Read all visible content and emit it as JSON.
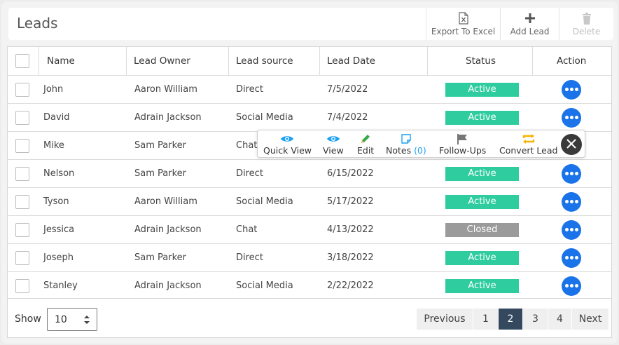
{
  "header": {
    "title": "Leads",
    "toolbar": [
      {
        "label": "Export To Excel",
        "icon": "excel-file-icon",
        "enabled": true
      },
      {
        "label": "Add Lead",
        "icon": "plus-icon",
        "enabled": true
      },
      {
        "label": "Delete",
        "icon": "trash-icon",
        "enabled": false
      }
    ]
  },
  "table": {
    "columns": [
      "Name",
      "Lead Owner",
      "Lead source",
      "Lead Date",
      "Status",
      "Action"
    ],
    "rows": [
      {
        "name": "John",
        "owner": "Aaron William",
        "source": "Direct",
        "date": "7/5/2022",
        "status": "Active"
      },
      {
        "name": "David",
        "owner": "Adrain Jackson",
        "source": "Social Media",
        "date": "7/4/2022",
        "status": "Active"
      },
      {
        "name": "Mike",
        "owner": "Sam Parker",
        "source": "Chat",
        "date": "",
        "status": ""
      },
      {
        "name": "Nelson",
        "owner": "Sam Parker",
        "source": "Direct",
        "date": "6/15/2022",
        "status": "Active"
      },
      {
        "name": "Tyson",
        "owner": "Aaron William",
        "source": "Social Media",
        "date": "5/17/2022",
        "status": "Active"
      },
      {
        "name": "Jessica",
        "owner": "Adrain Jackson",
        "source": "Chat",
        "date": "4/13/2022",
        "status": "Closed"
      },
      {
        "name": "Joseph",
        "owner": "Sam Parker",
        "source": "Direct",
        "date": "3/18/2022",
        "status": "Active"
      },
      {
        "name": "Stanley",
        "owner": "Adrain Jackson",
        "source": "Social Media",
        "date": "2/22/2022",
        "status": "Active"
      }
    ]
  },
  "status_colors": {
    "Active": "#2ecc9f",
    "Closed": "#9b9b9b"
  },
  "action_popup": {
    "quick_view": "Quick View",
    "view": "View",
    "edit": "Edit",
    "notes": "Notes",
    "notes_count": "(0)",
    "follow_ups": "Follow-Ups",
    "convert_lead": "Convert Lead"
  },
  "footer": {
    "show_label": "Show",
    "page_size": "10",
    "pagination": {
      "previous": "Previous",
      "pages": [
        "1",
        "2",
        "3",
        "4"
      ],
      "active_page": "2",
      "next": "Next"
    }
  },
  "colors": {
    "accent": "#1a73e8",
    "active_page_bg": "#34495e"
  }
}
